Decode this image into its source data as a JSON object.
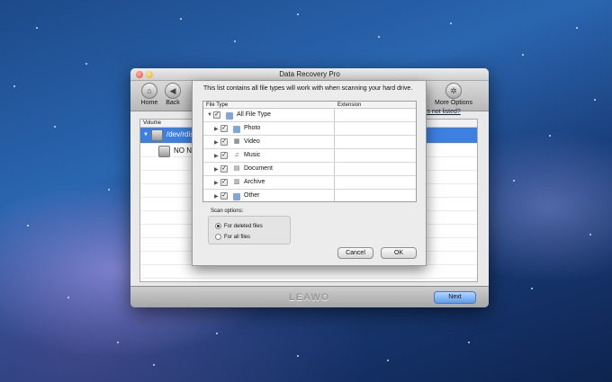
{
  "window": {
    "title": "Data Recovery Pro",
    "toolbar": {
      "home_label": "Home",
      "back_label": "Back",
      "more_options_label": "More Options"
    },
    "volumes": {
      "header": "Volume",
      "link_text": "y disk is not listed?",
      "rows": [
        {
          "name": "/dev/rdis"
        },
        {
          "name": "NO NA"
        }
      ]
    },
    "footer": {
      "logo_text": "LEAWO",
      "next_label": "Next"
    }
  },
  "dialog": {
    "message": "This list contains all file types will work with when scanning your hard drive.",
    "table": {
      "col_file_type": "File Type",
      "col_extension": "Extension",
      "root": {
        "label": "All File Type",
        "checked": true
      },
      "items": [
        {
          "label": "Photo",
          "icon": "photo-icon",
          "checked": true
        },
        {
          "label": "Video",
          "icon": "video-icon",
          "checked": true
        },
        {
          "label": "Music",
          "icon": "music-icon",
          "checked": true
        },
        {
          "label": "Document",
          "icon": "document-icon",
          "checked": true
        },
        {
          "label": "Archive",
          "icon": "archive-icon",
          "checked": true
        },
        {
          "label": "Other",
          "icon": "folder-icon",
          "checked": true
        }
      ]
    },
    "scan_options": {
      "title": "Scan options:",
      "options": [
        {
          "label": "For deleted files",
          "selected": true
        },
        {
          "label": "For all files",
          "selected": false
        }
      ]
    },
    "cancel_label": "Cancel",
    "ok_label": "OK"
  },
  "colors": {
    "selection_blue": "#3d80df",
    "next_button": "#5b9dee"
  }
}
